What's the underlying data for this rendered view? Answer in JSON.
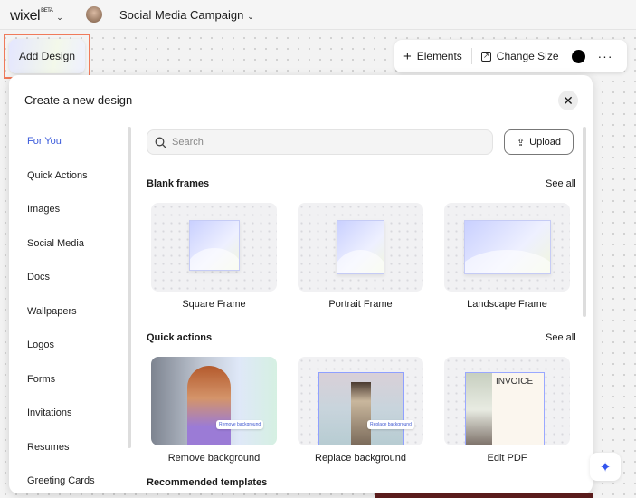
{
  "topbar": {
    "logo": "wixel",
    "badge": "BETA",
    "project": "Social Media Campaign"
  },
  "add_design": "Add Design",
  "toolbar": {
    "elements": "Elements",
    "change_size": "Change Size",
    "more": "···",
    "color": "#000000"
  },
  "modal": {
    "title": "Create a new design",
    "sidebar": [
      "For You",
      "Quick Actions",
      "Images",
      "Social Media",
      "Docs",
      "Wallpapers",
      "Logos",
      "Forms",
      "Invitations",
      "Resumes",
      "Greeting Cards"
    ],
    "search_placeholder": "Search",
    "upload": "Upload",
    "blank_frames": {
      "title": "Blank frames",
      "see_all": "See all",
      "items": [
        "Square Frame",
        "Portrait Frame",
        "Landscape Frame"
      ]
    },
    "quick_actions": {
      "title": "Quick actions",
      "see_all": "See all",
      "items": [
        "Remove background",
        "Replace background",
        "Edit PDF"
      ],
      "chips": {
        "remove": "Remove background",
        "replace": "Replace background",
        "invoice": "INVOICE"
      }
    },
    "recommended": "Recommended templates"
  }
}
